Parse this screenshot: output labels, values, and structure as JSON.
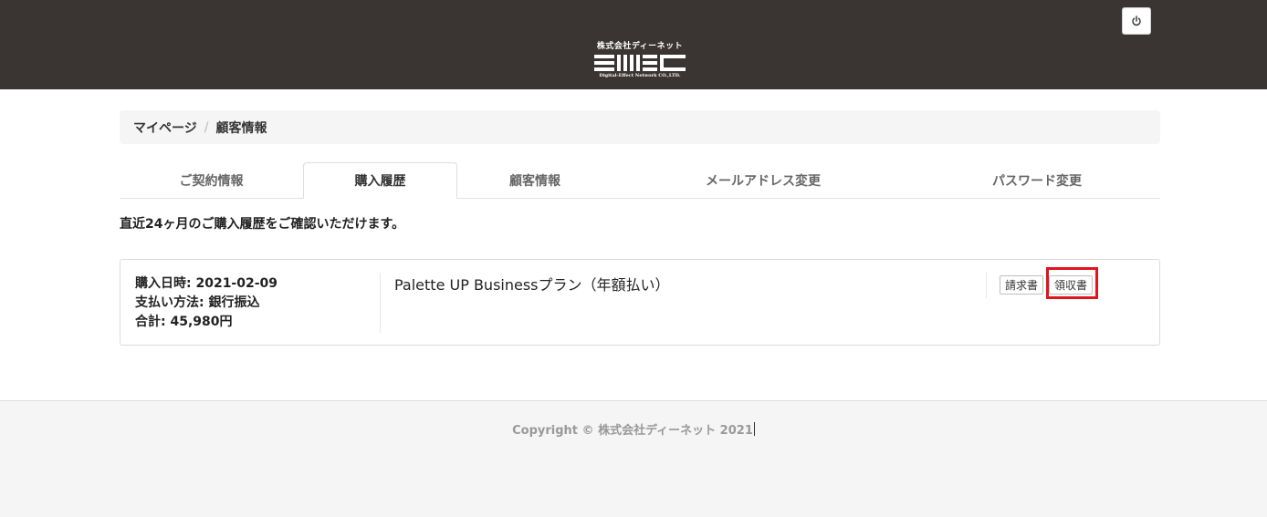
{
  "header": {
    "logo_company": "株式会社ディーネット",
    "logo_mark_text": "DeNet",
    "logo_subtitle": "Digital-Effect Network CO.,LTD.",
    "power_icon": "power-icon"
  },
  "breadcrumb": {
    "items": [
      "マイページ",
      "顧客情報"
    ],
    "separator": "/"
  },
  "tabs": [
    {
      "label": "ご契約情報",
      "active": false
    },
    {
      "label": "購入履歴",
      "active": true
    },
    {
      "label": "顧客情報",
      "active": false
    },
    {
      "label": "メールアドレス変更",
      "active": false
    },
    {
      "label": "パスワード変更",
      "active": false
    }
  ],
  "intro_text": "直近24ヶ月のご購入履歴をご確認いただけます。",
  "purchases": [
    {
      "date": "購入日時: 2021-02-09",
      "payment": "支払い方法: 銀行振込",
      "total": "合計: 45,980円",
      "plan": "Palette UP Businessプラン（年額払い）",
      "invoice_label": "請求書",
      "receipt_label": "領収書"
    }
  ],
  "footer": {
    "copyright": "Copyright © 株式会社ディーネット 2021"
  },
  "colors": {
    "header_bg": "#3a3532",
    "highlight": "#e0141e",
    "footer_bg": "#f5f5f5"
  }
}
